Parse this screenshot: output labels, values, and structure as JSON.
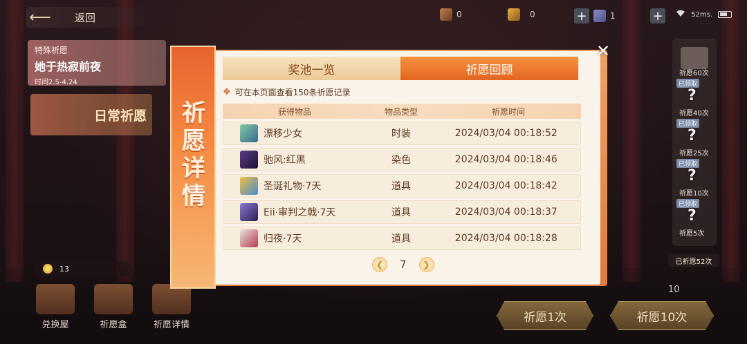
{
  "topbar": {
    "back_label": "返回",
    "currencies": [
      {
        "icon": "wand-icon",
        "value": "0"
      },
      {
        "icon": "wand-gold-icon",
        "value": "0"
      },
      {
        "icon": "cube-icon",
        "value": "1"
      }
    ],
    "ping": "52ms."
  },
  "left": {
    "banner_special": {
      "tag": "特殊祈愿",
      "title": "她于热寂前夜",
      "time": "时间2.5-4.24"
    },
    "banner_daily": {
      "title": "日常祈愿"
    },
    "gem_count": "13",
    "nav": [
      {
        "label": "兑换屋",
        "icon": "exchange-house-icon"
      },
      {
        "label": "祈愿盒",
        "icon": "wish-box-icon"
      },
      {
        "label": "祈愿详情",
        "icon": "wish-details-icon"
      }
    ]
  },
  "right": {
    "rewards": [
      {
        "label": "祈愿60次",
        "badge": "已领取"
      },
      {
        "label": "祈愿40次",
        "badge": "已领取"
      },
      {
        "label": "祈愿25次",
        "badge": "已领取"
      },
      {
        "label": "祈愿10次",
        "badge": "已领取"
      },
      {
        "label": "祈愿5次",
        "badge": ""
      }
    ],
    "total": "已祈愿52次",
    "cost_10": "10",
    "pray_1": "祈愿1次",
    "pray_10": "祈愿10次"
  },
  "modal": {
    "side_title": [
      "祈",
      "愿",
      "详",
      "情"
    ],
    "tabs": [
      {
        "label": "奖池一览",
        "active": false
      },
      {
        "label": "祈愿回顾",
        "active": true
      }
    ],
    "notice": "可在本页面查看150条祈愿记录",
    "columns": [
      "获得物品",
      "物品类型",
      "祈愿时间"
    ],
    "rows": [
      {
        "item": "漂移少女",
        "type": "时装",
        "time": "2024/03/04 00:18:52",
        "avatar_color": "#7ec8a8"
      },
      {
        "item": "驰风:红黑",
        "type": "染色",
        "time": "2024/03/04 00:18:46",
        "avatar_color": "#5a3a8c"
      },
      {
        "item": "圣诞礼物·7天",
        "type": "道具",
        "time": "2024/03/04 00:18:42",
        "avatar_color": "#4a8ad0"
      },
      {
        "item": "Eii·审判之戟·7天",
        "type": "道具",
        "time": "2024/03/04 00:18:37",
        "avatar_color": "#3a3060"
      },
      {
        "item": "归夜·7天",
        "type": "道具",
        "time": "2024/03/04 00:18:28",
        "avatar_color": "#b83a4a"
      }
    ],
    "page": "7"
  },
  "colors": {
    "accent_orange": "#e2651f",
    "tab_inactive": "#ecca96",
    "text_brown": "#5b3a24"
  }
}
